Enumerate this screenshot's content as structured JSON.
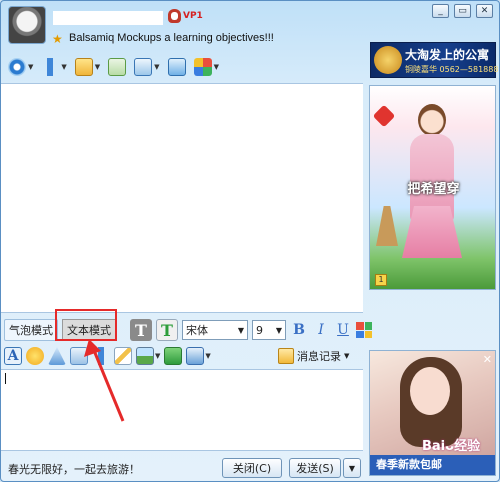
{
  "contact": {
    "vip_label": "VP1",
    "signature": "Balsamiq Mockups a learning objectives!!!"
  },
  "window_controls": {
    "minimize": "▭",
    "restore": "▭",
    "close": "×"
  },
  "ads": {
    "top": {
      "title": "大淘发上的公寓",
      "subtitle": "铜陵嘉华    0562—5818888"
    },
    "side": {
      "slogan": "把希望穿"
    },
    "bottom": {
      "brand": "Baiᴗ经验",
      "banner": "春季新款包邮"
    }
  },
  "toolbar": {
    "items": [
      "camera-icon",
      "microphone-icon",
      "transfer-icon",
      "add-app-icon",
      "screen-share-icon",
      "screenshot-icon",
      "more-apps-icon"
    ]
  },
  "format_bar": {
    "bubble_mode": "气泡模式",
    "text_mode": "文本模式",
    "font_name": "宋体",
    "font_size": "9",
    "bold": "B",
    "italic": "I",
    "underline": "U"
  },
  "input_toolbar": {
    "history_label": "消息记录"
  },
  "status": {
    "text": "春光无限好，一起去旅游！"
  },
  "buttons": {
    "close": "关闭(C)",
    "send": "发送(S)",
    "send_options": "▼"
  },
  "colors": {
    "highlight": "#e52a2a",
    "window_bg": "#cfe4f5",
    "accent": "#3a6fc4"
  }
}
